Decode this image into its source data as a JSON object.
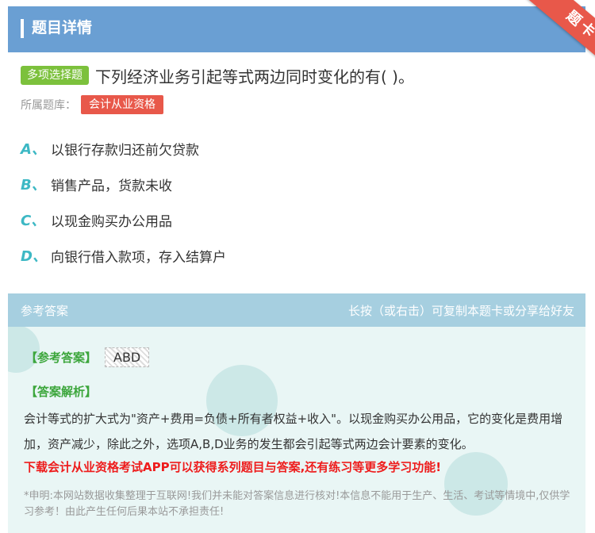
{
  "header": {
    "title": "题目详情",
    "corner_badge": "题卡"
  },
  "question": {
    "type_tag": "多项选择题",
    "text": "下列经济业务引起等式两边同时变化的有( )。",
    "bank_label": "所属题库：",
    "bank_name": "会计从业资格"
  },
  "options": [
    {
      "letter": "A、",
      "text": "以银行存款归还前欠贷款"
    },
    {
      "letter": "B、",
      "text": "销售产品，货款未收"
    },
    {
      "letter": "C、",
      "text": "以现金购买办公用品"
    },
    {
      "letter": "D、",
      "text": "向银行借入款项，存入结算户"
    }
  ],
  "answer": {
    "section_title": "参考答案",
    "hint": "长按（或右击）可复制本题卡或分享给好友",
    "ref_label": "【参考答案】",
    "ref_value": "ABD",
    "analysis_label": "【答案解析】",
    "analysis_text": "会计等式的扩大式为\"资产+费用=负债+所有者权益+收入\"。以现金购买办公用品，它的变化是费用增加，资产减少，除此之外，选项A,B,D业务的发生都会引起等式两边会计要素的变化。",
    "promo": "下载会计从业资格考试APP可以获得系列题目与答案,还有练习等更多学习功能!",
    "disclaimer": "*申明:本网站数据收集整理于互联网!我们并未能对答案信息进行核对!本信息不能用于生产、生活、考试等情境中,仅供学习参考！由此产生任何后果本站不承担责任!"
  },
  "colors": {
    "header_bg": "#6a9fd3",
    "ribbon": "#e8584a",
    "type_tag": "#7cc13c",
    "option_letter": "#3db8c4",
    "answer_green": "#3ca63c",
    "promo_red": "#ee1c1c"
  }
}
